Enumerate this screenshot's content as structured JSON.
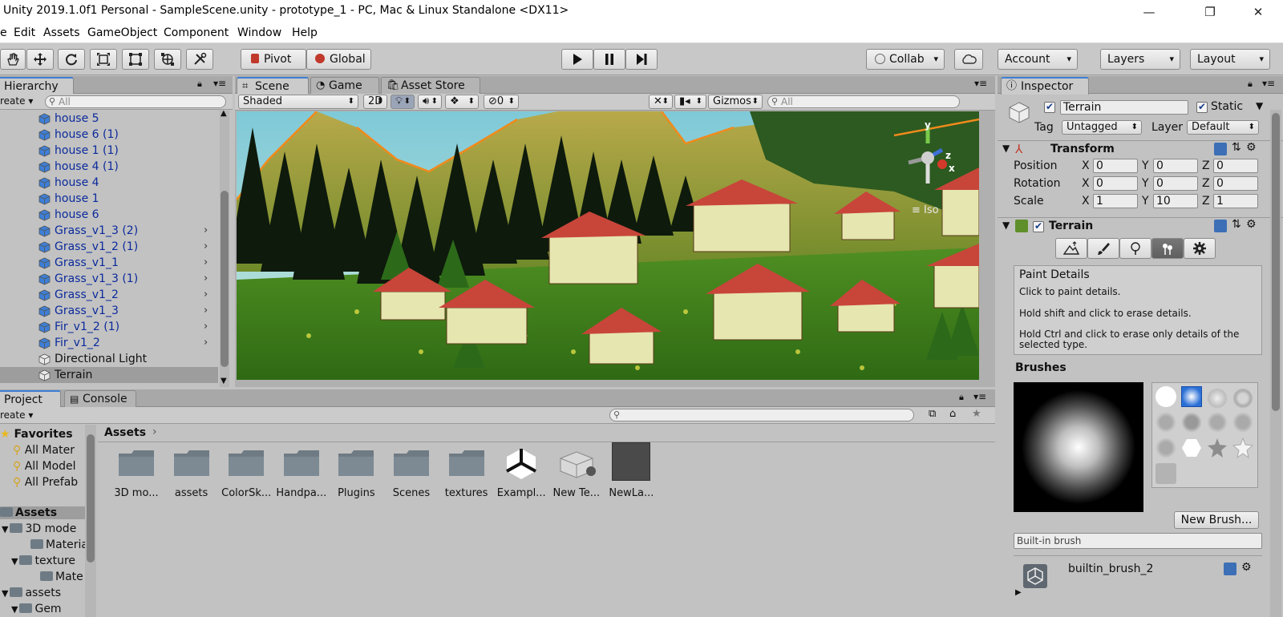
{
  "window": {
    "title": "Unity 2019.1.0f1 Personal - SampleScene.unity - prototype_1 - PC, Mac & Linux Standalone <DX11>",
    "minimize": "—",
    "maximize": "❐",
    "close": "✕"
  },
  "menu": [
    "e",
    "Edit",
    "Assets",
    "GameObject",
    "Component",
    "Window",
    "Help"
  ],
  "toolbar": {
    "pivot": "Pivot",
    "global": "Global",
    "collab": "Collab",
    "account": "Account",
    "layers": "Layers",
    "layout": "Layout"
  },
  "hierarchy": {
    "tab": "Hierarchy",
    "create": "reate",
    "search_placeholder": "All",
    "items": [
      {
        "label": "house 5",
        "prefab": true,
        "children": false
      },
      {
        "label": "house 6 (1)",
        "prefab": true,
        "children": false
      },
      {
        "label": "house 1 (1)",
        "prefab": true,
        "children": false
      },
      {
        "label": "house 4 (1)",
        "prefab": true,
        "children": false
      },
      {
        "label": "house 4",
        "prefab": true,
        "children": false
      },
      {
        "label": "house 1",
        "prefab": true,
        "children": false
      },
      {
        "label": "house 6",
        "prefab": true,
        "children": false
      },
      {
        "label": "Grass_v1_3 (2)",
        "prefab": true,
        "children": true
      },
      {
        "label": "Grass_v1_2 (1)",
        "prefab": true,
        "children": true
      },
      {
        "label": "Grass_v1_1",
        "prefab": true,
        "children": true
      },
      {
        "label": "Grass_v1_3 (1)",
        "prefab": true,
        "children": true
      },
      {
        "label": "Grass_v1_2",
        "prefab": true,
        "children": true
      },
      {
        "label": "Grass_v1_3",
        "prefab": true,
        "children": true
      },
      {
        "label": "Fir_v1_2 (1)",
        "prefab": true,
        "children": true
      },
      {
        "label": "Fir_v1_2",
        "prefab": true,
        "children": true
      },
      {
        "label": "Directional Light",
        "prefab": false,
        "children": false
      },
      {
        "label": "Terrain",
        "prefab": false,
        "children": false,
        "selected": true
      }
    ]
  },
  "scene": {
    "tabs": [
      "Scene",
      "Game",
      "Asset Store"
    ],
    "shading": "Shaded",
    "mode2d": "2D",
    "hidden_count": "0",
    "gizmos": "Gizmos",
    "search_placeholder": "All",
    "axis_y": "y",
    "axis_z": "z",
    "axis_x": "x",
    "iso": "Iso"
  },
  "project": {
    "tabs": [
      "Project",
      "Console"
    ],
    "create": "reate",
    "breadcrumb": "Assets",
    "favorites": {
      "title": "Favorites",
      "items": [
        "All Mater",
        "All Model",
        "All Prefab"
      ]
    },
    "tree_root": "Assets",
    "tree": [
      {
        "label": "3D mode",
        "indent": 0,
        "arrow": "▼"
      },
      {
        "label": "Materia",
        "indent": 2,
        "arrow": ""
      },
      {
        "label": "texture",
        "indent": 1,
        "arrow": "▼"
      },
      {
        "label": "Mate",
        "indent": 3,
        "arrow": ""
      },
      {
        "label": "assets",
        "indent": 0,
        "arrow": "▼"
      },
      {
        "label": "Gem",
        "indent": 1,
        "arrow": "▼"
      }
    ],
    "assets": [
      "3D mo...",
      "assets",
      "ColorSk...",
      "Handpa...",
      "Plugins",
      "Scenes",
      "textures",
      "Exampl...",
      "New Te...",
      "NewLa..."
    ]
  },
  "inspector": {
    "tab": "Inspector",
    "object_name": "Terrain",
    "static_label": "Static",
    "tag_label": "Tag",
    "tag_value": "Untagged",
    "layer_label": "Layer",
    "layer_value": "Default",
    "transform": {
      "title": "Transform",
      "rows": [
        {
          "label": "Position",
          "x": "0",
          "y": "0",
          "z": "0"
        },
        {
          "label": "Rotation",
          "x": "0",
          "y": "0",
          "z": "0"
        },
        {
          "label": "Scale",
          "x": "1",
          "y": "10",
          "z": "1"
        }
      ],
      "axis_x": "X",
      "axis_y": "Y",
      "axis_z": "Z"
    },
    "terrain": {
      "title": "Terrain",
      "help_title": "Paint Details",
      "help_lines": [
        "Click to paint details.",
        "Hold shift and click to erase details.",
        "Hold Ctrl and click to erase only details of the selected type."
      ],
      "brushes_label": "Brushes",
      "new_brush": "New Brush...",
      "brush_field": "Built-in brush",
      "brush_name": "builtin_brush_2"
    }
  },
  "colors": {
    "accent": "#3d7fd6",
    "prefab_text": "#0b2a9c",
    "panel": "#c2c2c2",
    "selection": "#9d9d9d",
    "outline": "#f08a1c"
  }
}
